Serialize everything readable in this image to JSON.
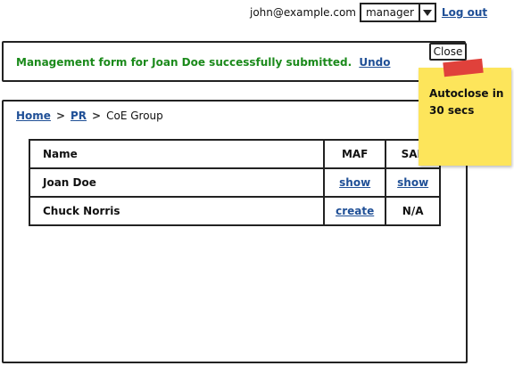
{
  "header": {
    "user_email": "john@example.com",
    "role_selected": "manager",
    "logout_label": "Log out"
  },
  "notice": {
    "message": "Management form for Joan Doe successfully submitted.",
    "undo_label": "Undo",
    "close_label": "Close"
  },
  "sticky_note": {
    "text": "Autoclose in 30 secs"
  },
  "breadcrumb": {
    "items": [
      "Home",
      "PR"
    ],
    "current": "CoE Group",
    "separator": ">"
  },
  "table": {
    "headers": [
      "Name",
      "MAF",
      "SAF"
    ],
    "rows": [
      {
        "name": "Joan Doe",
        "maf": "show",
        "saf": "show"
      },
      {
        "name": "Chuck Norris",
        "maf": "create",
        "saf": "N/A"
      }
    ]
  },
  "colors": {
    "success": "#1b8a1b",
    "link": "#1f4f96",
    "sticky": "#fde55b",
    "pin": "#e0413b"
  }
}
